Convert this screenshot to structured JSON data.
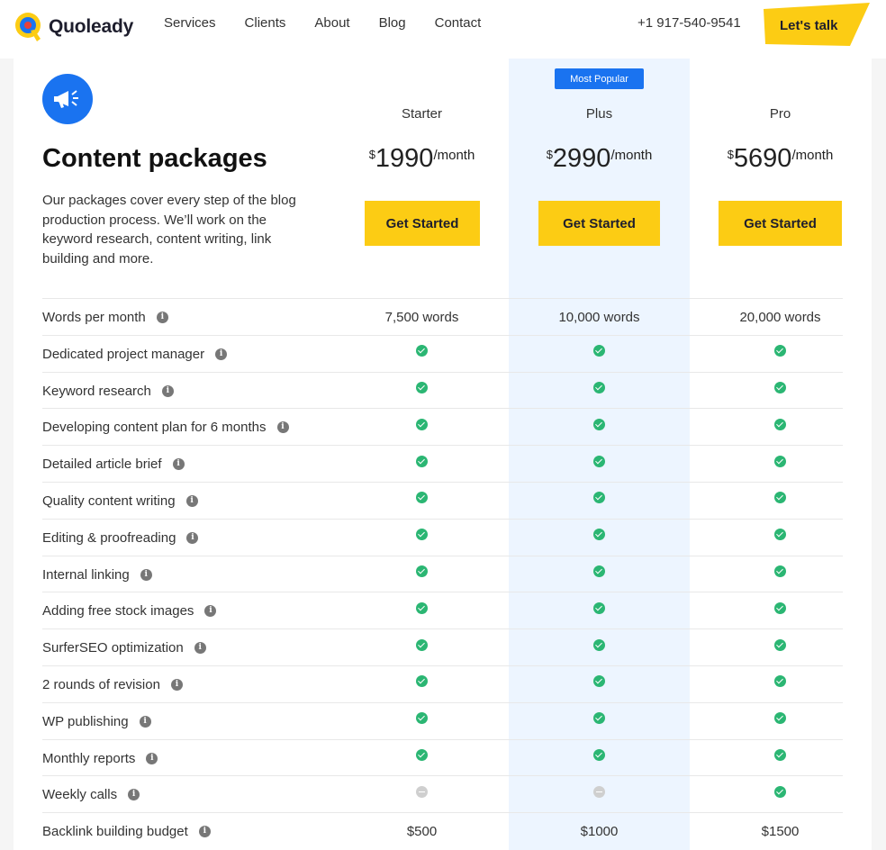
{
  "header": {
    "brand": "Quoleady",
    "nav": [
      "Services",
      "Clients",
      "About",
      "Blog",
      "Contact"
    ],
    "phone": "+1 917-540-9541",
    "cta": "Let's talk",
    "colors": {
      "brand_yellow": "#fccc14",
      "brand_blue": "#1a73f0"
    }
  },
  "intro": {
    "icon": "megaphone-icon",
    "title": "Content packages",
    "description": "Our packages cover every step of the blog production process. We’ll work on the keyword research, content writing, link building and more."
  },
  "plans": [
    {
      "name": "Starter",
      "currency": "$",
      "amount": "1990",
      "period": "/month",
      "button": "Get Started"
    },
    {
      "name": "Plus",
      "currency": "$",
      "amount": "2990",
      "period": "/month",
      "button": "Get Started",
      "badge": "Most Popular"
    },
    {
      "name": "Pro",
      "currency": "$",
      "amount": "5690",
      "period": "/month",
      "button": "Get Started"
    }
  ],
  "features": [
    {
      "name": "Words per month",
      "values": [
        "7,500 words",
        "10,000 words",
        "20,000 words"
      ]
    },
    {
      "name": "Dedicated project manager",
      "values": [
        "check",
        "check",
        "check"
      ]
    },
    {
      "name": "Keyword research",
      "values": [
        "check",
        "check",
        "check"
      ]
    },
    {
      "name": "Developing content plan for 6 months",
      "values": [
        "check",
        "check",
        "check"
      ]
    },
    {
      "name": "Detailed article brief",
      "values": [
        "check",
        "check",
        "check"
      ]
    },
    {
      "name": "Quality content writing",
      "values": [
        "check",
        "check",
        "check"
      ]
    },
    {
      "name": "Editing & proofreading",
      "values": [
        "check",
        "check",
        "check"
      ]
    },
    {
      "name": "Internal linking",
      "values": [
        "check",
        "check",
        "check"
      ]
    },
    {
      "name": "Adding free stock images",
      "values": [
        "check",
        "check",
        "check"
      ]
    },
    {
      "name": "SurferSEO optimization",
      "values": [
        "check",
        "check",
        "check"
      ]
    },
    {
      "name": "2 rounds of revision",
      "values": [
        "check",
        "check",
        "check"
      ]
    },
    {
      "name": "WP publishing",
      "values": [
        "check",
        "check",
        "check"
      ]
    },
    {
      "name": "Monthly reports",
      "values": [
        "check",
        "check",
        "check"
      ]
    },
    {
      "name": "Weekly calls",
      "values": [
        "dash",
        "dash",
        "check"
      ]
    },
    {
      "name": "Backlink building budget",
      "values": [
        "$500",
        "$1000",
        "$1500"
      ]
    }
  ]
}
